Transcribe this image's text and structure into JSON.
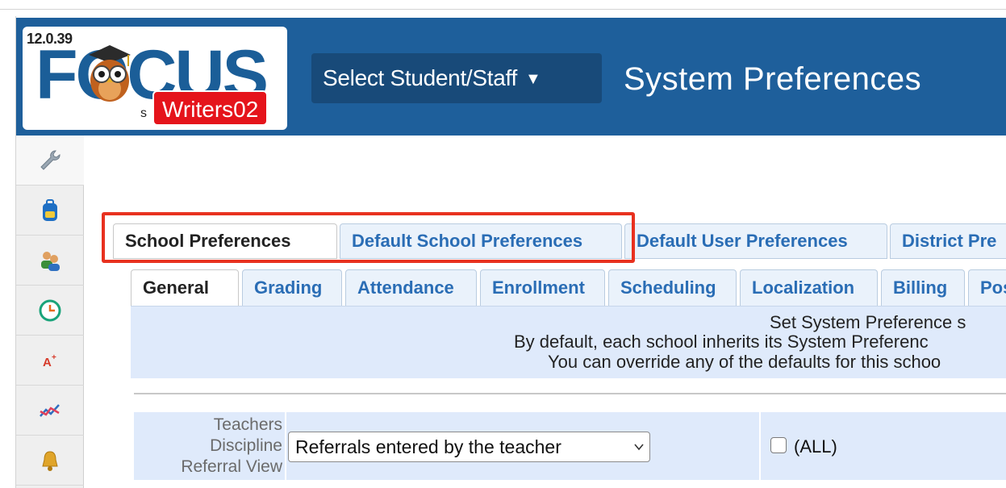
{
  "header": {
    "version": "12.0.39",
    "logo_text": "FOCUS",
    "logo_subtext": "s",
    "user_badge": "Writers02",
    "select_button_label": "Select Student/Staff",
    "select_button_caret": "▼",
    "page_title": "System Preferences",
    "brand_color": "#1e5f9b",
    "badge_color": "#e5141b"
  },
  "sidebar": {
    "items": [
      {
        "icon": "wrench-icon"
      },
      {
        "icon": "backpack-icon"
      },
      {
        "icon": "users-icon"
      },
      {
        "icon": "clock-icon"
      },
      {
        "icon": "grade-a-plus-icon"
      },
      {
        "icon": "chart-icon"
      },
      {
        "icon": "bell-icon"
      }
    ]
  },
  "tabs_primary": [
    {
      "label": "School Preferences",
      "active": true
    },
    {
      "label": "Default School Preferences",
      "active": false
    },
    {
      "label": "Default User Preferences",
      "active": false
    },
    {
      "label": "District Pre",
      "active": false
    }
  ],
  "tabs_secondary": [
    {
      "label": "General",
      "active": true
    },
    {
      "label": "Grading",
      "active": false
    },
    {
      "label": "Attendance",
      "active": false
    },
    {
      "label": "Enrollment",
      "active": false
    },
    {
      "label": "Scheduling",
      "active": false
    },
    {
      "label": "Localization",
      "active": false
    },
    {
      "label": "Billing",
      "active": false
    },
    {
      "label": "Pos",
      "active": false
    }
  ],
  "info": {
    "line1": "Set System Preference s",
    "line2": "By default, each school inherits its System Preferenc",
    "line3": "You can override any of the defaults for this schoo"
  },
  "setting_row": {
    "label_line1": "Teachers",
    "label_line2": "Discipline",
    "label_line3": "Referral View",
    "select_value": "Referrals entered by the teacher",
    "checkbox_label": "(ALL)",
    "checkbox_checked": false
  },
  "highlight_color": "#e8311f"
}
